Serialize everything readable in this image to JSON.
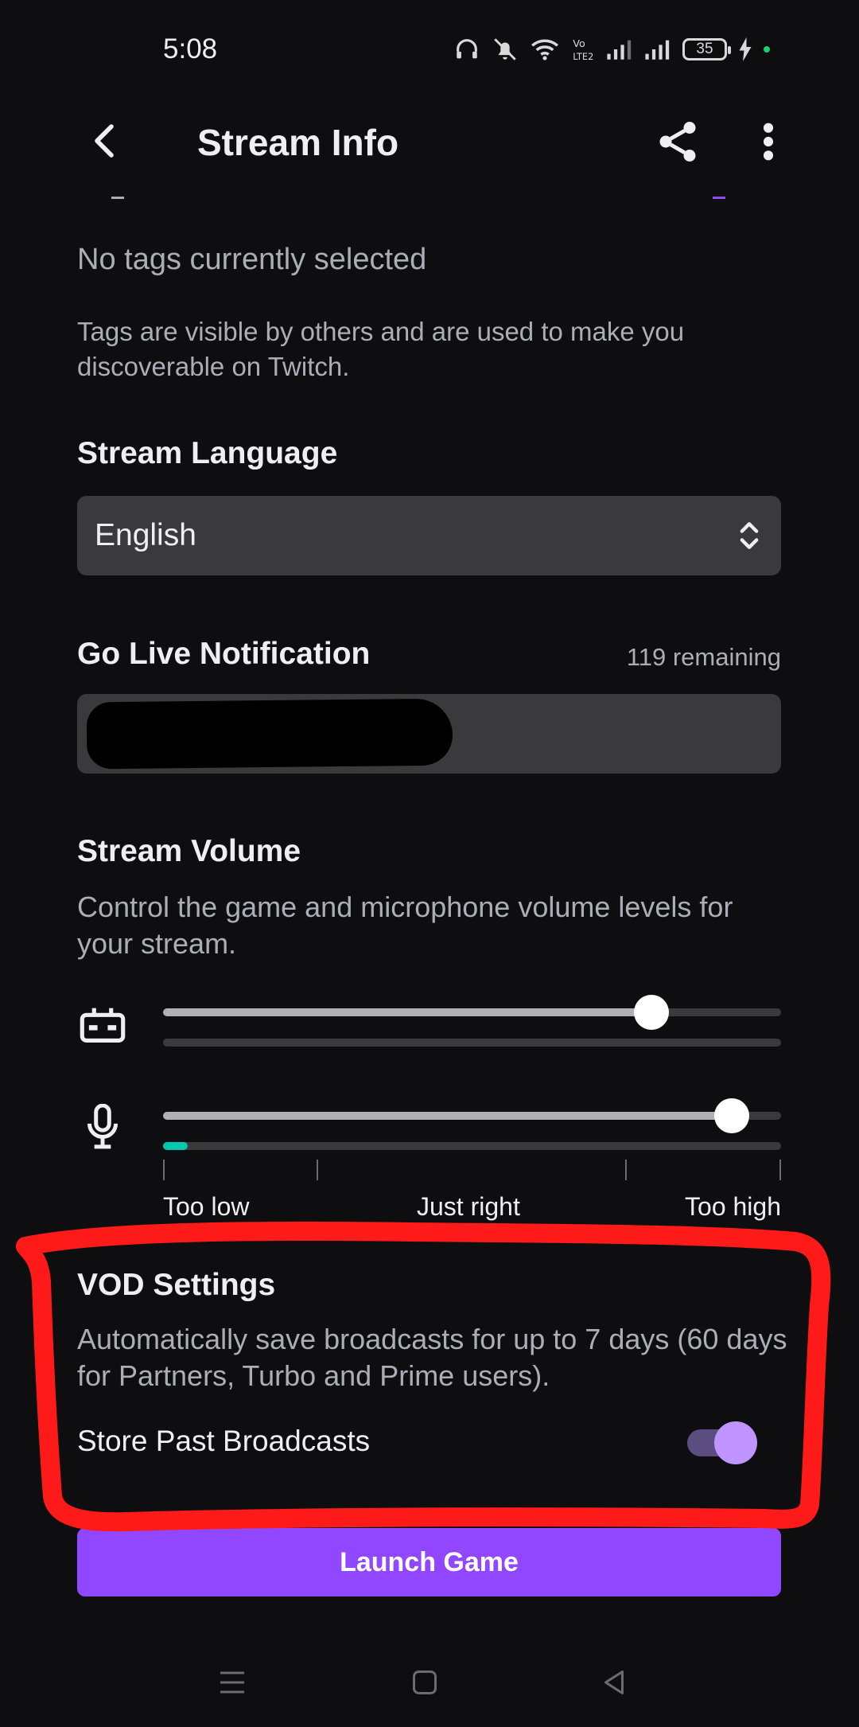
{
  "status_bar": {
    "time": "5:08",
    "battery": "35"
  },
  "header": {
    "title": "Stream Info"
  },
  "tags": {
    "empty_text": "No tags currently selected",
    "help_text": "Tags are visible by others and are used to make you discoverable on Twitch."
  },
  "language": {
    "title": "Stream Language",
    "selected": "English"
  },
  "notification": {
    "title": "Go Live Notification",
    "remaining": "119 remaining"
  },
  "volume": {
    "title": "Stream Volume",
    "description": "Control the game and microphone volume levels for your stream.",
    "game_level": 0.79,
    "game_meter": 0,
    "mic_level": 0.92,
    "mic_meter": 0.04,
    "labels": {
      "low": "Too low",
      "right": "Just right",
      "high": "Too high"
    }
  },
  "vod": {
    "title": "VOD Settings",
    "description": "Automatically save broadcasts for up to 7 days (60 days for Partners, Turbo and Prime users).",
    "store_label": "Store Past Broadcasts",
    "store_enabled": true
  },
  "launch_button": "Launch Game",
  "colors": {
    "accent": "#9147ff",
    "toggle_on": "#bf94ff",
    "meter": "#00c8af",
    "annotation": "#ff1a1a"
  },
  "icons": {
    "back": "back-arrow-icon",
    "share": "share-icon",
    "more": "more-vertical-icon",
    "game": "gamepad-icon",
    "mic": "microphone-icon",
    "select": "chevron-up-down-icon"
  }
}
